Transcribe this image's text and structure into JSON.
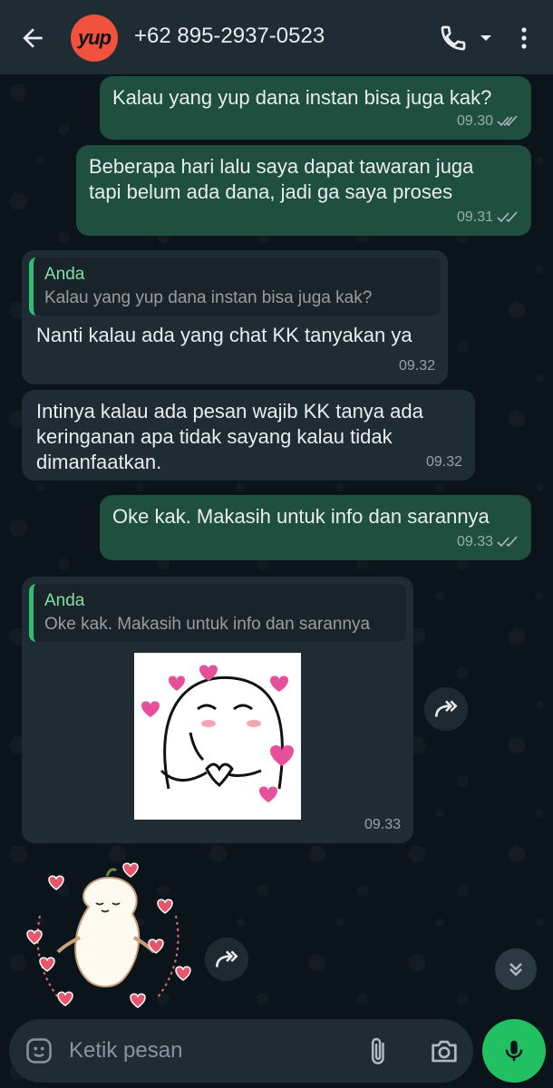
{
  "header": {
    "avatar_text": "yup",
    "contact_name": "+62 895-2937-0523"
  },
  "messages": [
    {
      "direction": "out",
      "text": "Kalau yang yup dana instan bisa juga kak?",
      "time": "09.30"
    },
    {
      "direction": "out",
      "text": "Beberapa hari lalu saya dapat tawaran juga\ntapi belum ada dana, jadi ga saya proses",
      "time": "09.31"
    },
    {
      "direction": "in",
      "quote_author": "Anda",
      "quote_text": "Kalau yang yup dana instan bisa juga kak?",
      "text": "Nanti kalau ada yang chat KK tanyakan ya",
      "time": "09.32"
    },
    {
      "direction": "in",
      "text": "Intinya kalau ada pesan wajib KK tanya ada\nkeringanan apa tidak sayang kalau tidak\ndimanfaatkan.",
      "time": "09.32"
    },
    {
      "direction": "out",
      "text": "Oke kak. Makasih untuk info dan sarannya",
      "time": "09.33"
    },
    {
      "direction": "in",
      "quote_author": "Anda",
      "quote_text": "Oke kak. Makasih untuk info dan sarannya",
      "sticker": "blushing-heart-sticker",
      "time": "09.33"
    },
    {
      "direction": "in",
      "sticker": "hearts-sticker"
    }
  ],
  "input": {
    "placeholder": "Ketik pesan"
  },
  "colors": {
    "header_bg": "#1f2c33",
    "outgoing_bubble": "#1f4f3e",
    "incoming_bubble": "#202c33",
    "accent_green": "#21c063",
    "avatar_bg": "#f0523d"
  },
  "icons": [
    "back-arrow-icon",
    "phone-icon",
    "chevron-down-icon",
    "more-vert-icon",
    "double-check-icon",
    "forward-icon",
    "double-chevron-down-icon",
    "emoji-icon",
    "paperclip-icon",
    "camera-icon",
    "mic-icon"
  ]
}
